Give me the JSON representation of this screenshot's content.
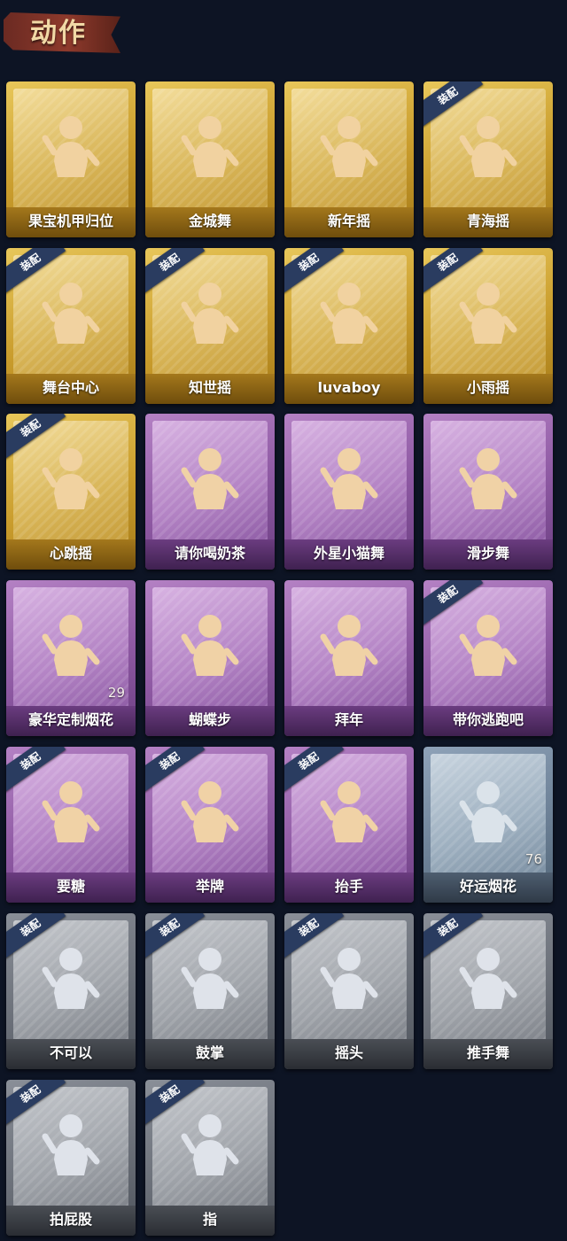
{
  "header": {
    "title": "动作"
  },
  "cards": [
    {
      "label": "果宝机甲归位",
      "rarity": "gold",
      "equipped": false,
      "count": null
    },
    {
      "label": "金城舞",
      "rarity": "gold",
      "equipped": false,
      "count": null
    },
    {
      "label": "新年摇",
      "rarity": "gold",
      "equipped": false,
      "count": null
    },
    {
      "label": "青海摇",
      "rarity": "gold",
      "equipped": true,
      "count": null
    },
    {
      "label": "舞台中心",
      "rarity": "gold",
      "equipped": true,
      "count": null
    },
    {
      "label": "知世摇",
      "rarity": "gold",
      "equipped": true,
      "count": null
    },
    {
      "label": "luvaboy",
      "rarity": "gold",
      "equipped": true,
      "count": null
    },
    {
      "label": "小雨摇",
      "rarity": "gold",
      "equipped": true,
      "count": null
    },
    {
      "label": "心跳摇",
      "rarity": "gold",
      "equipped": true,
      "count": null
    },
    {
      "label": "请你喝奶茶",
      "rarity": "purple",
      "equipped": false,
      "count": null
    },
    {
      "label": "外星小猫舞",
      "rarity": "purple",
      "equipped": false,
      "count": null
    },
    {
      "label": "滑步舞",
      "rarity": "purple",
      "equipped": false,
      "count": null
    },
    {
      "label": "豪华定制烟花",
      "rarity": "purple",
      "equipped": false,
      "count": "29"
    },
    {
      "label": "蝴蝶步",
      "rarity": "purple",
      "equipped": false,
      "count": null
    },
    {
      "label": "拜年",
      "rarity": "purple",
      "equipped": false,
      "count": null
    },
    {
      "label": "带你逃跑吧",
      "rarity": "purple",
      "equipped": true,
      "count": null
    },
    {
      "label": "要糖",
      "rarity": "purple",
      "equipped": true,
      "count": null
    },
    {
      "label": "举牌",
      "rarity": "purple",
      "equipped": true,
      "count": null
    },
    {
      "label": "抬手",
      "rarity": "purple",
      "equipped": true,
      "count": null
    },
    {
      "label": "好运烟花",
      "rarity": "blue",
      "equipped": false,
      "count": "76"
    },
    {
      "label": "不可以",
      "rarity": "grey",
      "equipped": true,
      "count": null
    },
    {
      "label": "鼓掌",
      "rarity": "grey",
      "equipped": true,
      "count": null
    },
    {
      "label": "摇头",
      "rarity": "grey",
      "equipped": true,
      "count": null
    },
    {
      "label": "推手舞",
      "rarity": "grey",
      "equipped": true,
      "count": null
    },
    {
      "label": "拍屁股",
      "rarity": "grey",
      "equipped": true,
      "count": null
    },
    {
      "label": "指",
      "rarity": "grey",
      "equipped": true,
      "count": null
    }
  ],
  "equip_badge_label": "装配",
  "colors": {
    "background": "#0d1424",
    "gold": "#d2a63c",
    "purple": "#9a66ad",
    "blue": "#7c90a3",
    "grey": "#7a7f87",
    "badge": "#2a3c60"
  }
}
